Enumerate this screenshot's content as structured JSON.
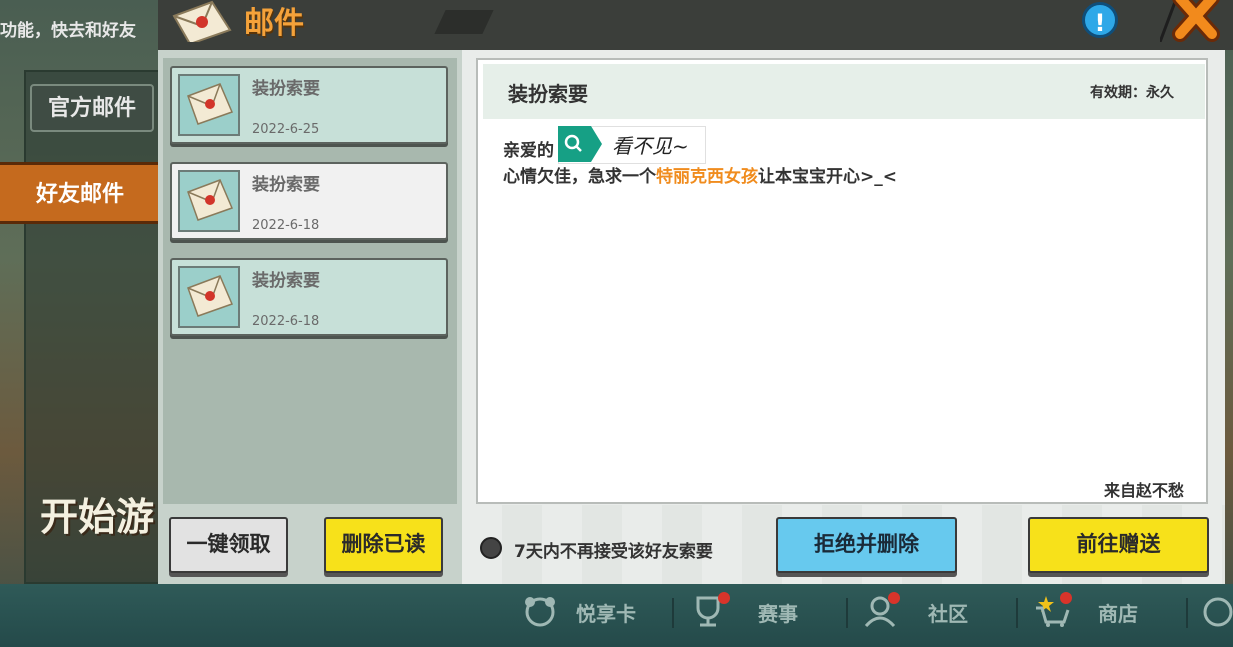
{
  "background": {
    "top_text": "功能，快去和好友",
    "start_text": "开始游",
    "tabs": [
      {
        "label": "官方邮件"
      },
      {
        "label": "好友邮件"
      }
    ]
  },
  "window": {
    "title": "邮件",
    "help_label": "!"
  },
  "mail_list": [
    {
      "subject": "装扮索要",
      "date": "2022-6-25",
      "state": "unread"
    },
    {
      "subject": "装扮索要",
      "date": "2022-6-18",
      "state": "read"
    },
    {
      "subject": "装扮索要",
      "date": "2022-6-18",
      "state": "unread"
    }
  ],
  "left_actions": {
    "claim_all": "一键领取",
    "delete_read": "删除已读"
  },
  "letter": {
    "subject": "装扮索要",
    "validity": "有效期：永久",
    "greeting": "亲爱的",
    "redacted_name": "看不见~",
    "line2_prefix": "心情欠佳，急求一个",
    "line2_highlight": "特丽克西女孩",
    "line2_suffix": "让本宝宝开心>_<",
    "from": "来自赵不愁"
  },
  "footer": {
    "block_option": "7天内不再接受该好友索要",
    "reject_button": "拒绝并删除",
    "send_button": "前往赠送"
  },
  "bottom_nav": [
    {
      "label": "悦享卡",
      "icon": "card-icon"
    },
    {
      "label": "赛事",
      "icon": "trophy-icon"
    },
    {
      "label": "社区",
      "icon": "community-icon"
    },
    {
      "label": "商店",
      "icon": "shop-cart-icon"
    }
  ],
  "colors": {
    "title_orange": "#f5a23a",
    "highlight_orange": "#f08c1e",
    "yellow_button": "#f7e11a",
    "blue_button": "#67c9ee"
  }
}
